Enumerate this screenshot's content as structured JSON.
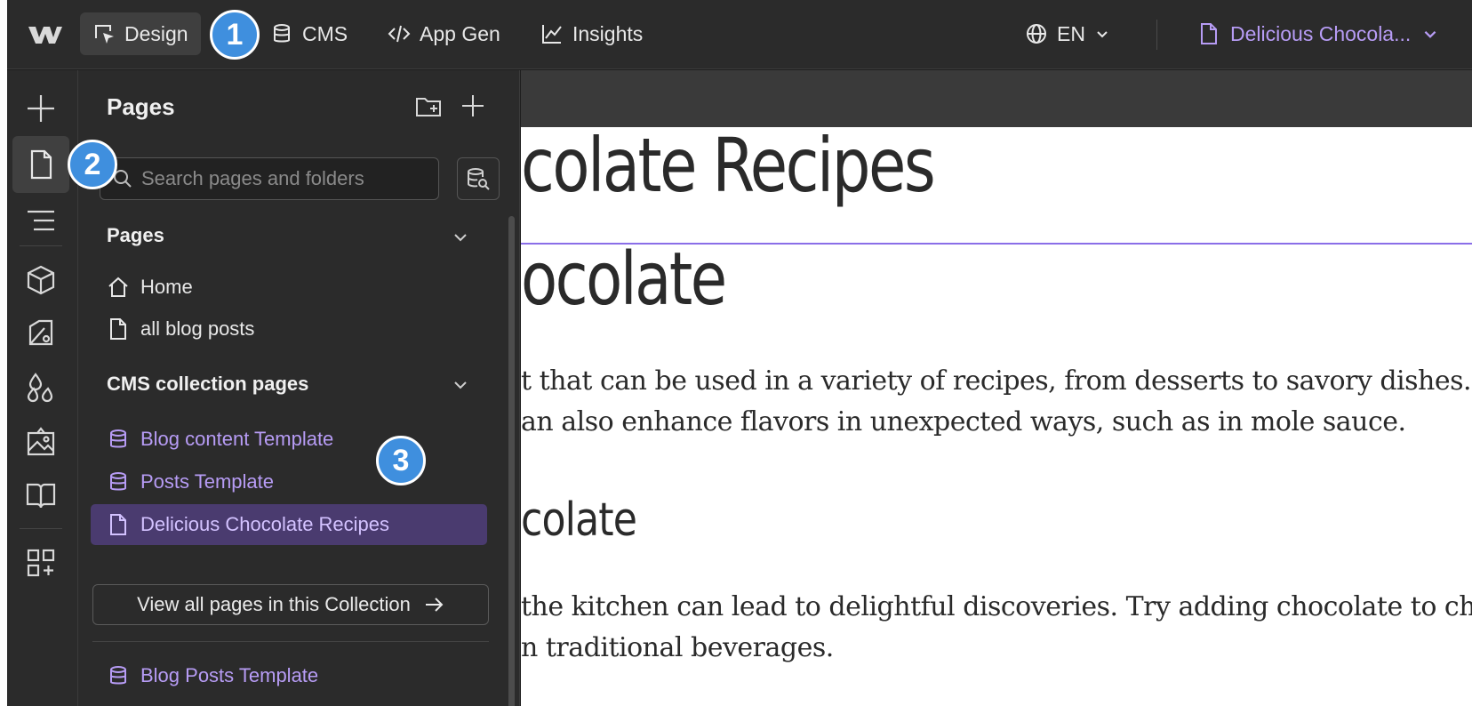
{
  "topbar": {
    "nav": [
      {
        "label": "Design",
        "icon": "cursor-select-icon"
      },
      {
        "label": "CMS",
        "icon": "database-icon"
      },
      {
        "label": "App Gen",
        "icon": "code-icon"
      },
      {
        "label": "Insights",
        "icon": "line-chart-icon"
      }
    ],
    "language": "EN",
    "current_page": "Delicious Chocola..."
  },
  "badges": [
    "1",
    "2",
    "3"
  ],
  "panel": {
    "title": "Pages",
    "search_placeholder": "Search pages and folders",
    "sections": {
      "pages": {
        "heading": "Pages",
        "items": [
          {
            "label": "Home",
            "icon": "home-icon"
          },
          {
            "label": "all blog posts",
            "icon": "page-icon"
          }
        ]
      },
      "cms": {
        "heading": "CMS collection pages",
        "items": [
          {
            "label": "Blog content Template",
            "icon": "database-icon"
          },
          {
            "label": "Posts Template",
            "icon": "database-icon"
          },
          {
            "label": "Delicious Chocolate Recipes",
            "icon": "page-icon",
            "selected": true
          }
        ],
        "view_all": "View all pages in this Collection"
      },
      "more": [
        {
          "label": "Blog Posts Template",
          "icon": "database-icon"
        }
      ]
    }
  },
  "canvas": {
    "heading1": "colate Recipes",
    "heading2": "ocolate",
    "para1_line1": "t that can be used in a variety of recipes, from desserts to savory dishes.",
    "para1_line2": "an also enhance flavors in unexpected ways, such as in mole sauce.",
    "heading3": "colate",
    "para2_line1": "the kitchen can lead to delightful discoveries. Try adding chocolate to ch",
    "para2_line2": "n traditional beverages."
  },
  "colors": {
    "accent_purple": "#b79cf5",
    "selected_bg": "#4a3b6f",
    "badge_blue": "#3f8fde",
    "selection_line": "#8a6ee8"
  }
}
